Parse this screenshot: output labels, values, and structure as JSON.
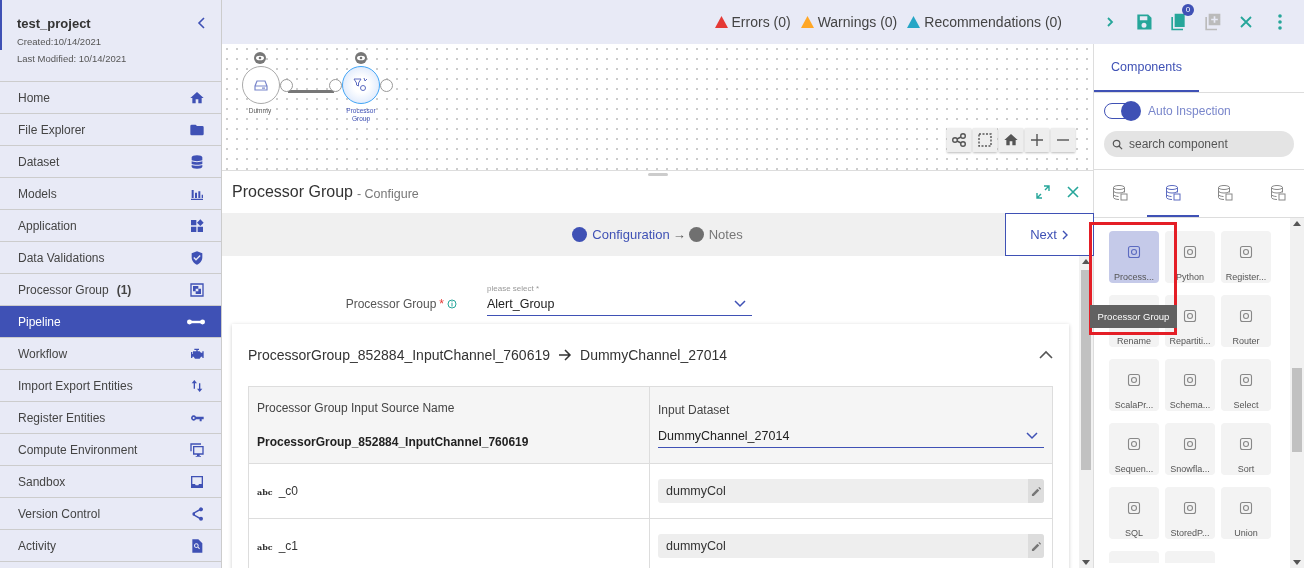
{
  "sidebar": {
    "project": "test_project",
    "created": "Created:10/14/2021",
    "modified": "Last Modified: 10/14/2021",
    "items": [
      {
        "label": "Home",
        "selected": false
      },
      {
        "label": "File Explorer",
        "selected": false
      },
      {
        "label": "Dataset",
        "selected": false
      },
      {
        "label": "Models",
        "selected": false
      },
      {
        "label": "Application",
        "selected": false
      },
      {
        "label": "Data Validations",
        "selected": false
      },
      {
        "label": "Processor Group",
        "count": "(1)",
        "selected": false
      },
      {
        "label": "Pipeline",
        "selected": true
      },
      {
        "label": "Workflow",
        "selected": false
      },
      {
        "label": "Import Export Entities",
        "selected": false
      },
      {
        "label": "Register Entities",
        "selected": false
      },
      {
        "label": "Compute Environment",
        "selected": false
      },
      {
        "label": "Sandbox",
        "selected": false
      },
      {
        "label": "Version Control",
        "selected": false
      },
      {
        "label": "Activity",
        "selected": false
      }
    ]
  },
  "toolbar": {
    "alerts": [
      "Errors (0)",
      "Warnings (0)",
      "Recommendations (0)"
    ],
    "badge": "0"
  },
  "canvas": {
    "nodes": [
      {
        "label": "Dummy",
        "selected": false
      },
      {
        "label": "Processor Group",
        "selected": true
      }
    ]
  },
  "panel": {
    "title": "Processor Group",
    "subtitle": "- Configure",
    "steps": [
      {
        "label": "Configuration",
        "selected": true
      },
      {
        "label": "Notes",
        "selected": false
      }
    ],
    "step_arrow": "→",
    "next": "Next",
    "field": {
      "label": "Processor Group",
      "required": "*",
      "hint": "please select *",
      "value": "Alert_Group"
    },
    "mapping": {
      "source": "ProcessorGroup_852884_InputChannel_760619",
      "target": "DummyChannel_27014",
      "columns": [
        "Processor Group Input Source Name",
        "Input Dataset"
      ],
      "source_name": "ProcessorGroup_852884_InputChannel_760619",
      "dataset": "DummyChannel_27014",
      "rows": [
        {
          "type": "abc",
          "name": "_c0",
          "value": "dummyCol"
        },
        {
          "type": "abc",
          "name": "_c1",
          "value": "dummyCol"
        }
      ]
    }
  },
  "components": {
    "tab": "Components",
    "auto_inspection": {
      "label": "Auto Inspection",
      "on": true
    },
    "search_placeholder": "search component",
    "category_tabs": [
      {
        "selected": false
      },
      {
        "selected": true
      },
      {
        "selected": false
      },
      {
        "selected": false
      }
    ],
    "tooltip": "Processor Group",
    "items": [
      {
        "label": "Process...",
        "selected": true
      },
      {
        "label": "Python",
        "selected": false
      },
      {
        "label": "Register...",
        "selected": false
      },
      {
        "label": "Rename",
        "selected": false
      },
      {
        "label": "Repartiti...",
        "selected": false
      },
      {
        "label": "Router",
        "selected": false
      },
      {
        "label": "ScalaPr...",
        "selected": false
      },
      {
        "label": "Schema...",
        "selected": false
      },
      {
        "label": "Select",
        "selected": false
      },
      {
        "label": "Sequen...",
        "selected": false
      },
      {
        "label": "Snowfla...",
        "selected": false
      },
      {
        "label": "Sort",
        "selected": false
      },
      {
        "label": "SQL",
        "selected": false
      },
      {
        "label": "StoredP...",
        "selected": false
      },
      {
        "label": "Union",
        "selected": false
      }
    ]
  }
}
